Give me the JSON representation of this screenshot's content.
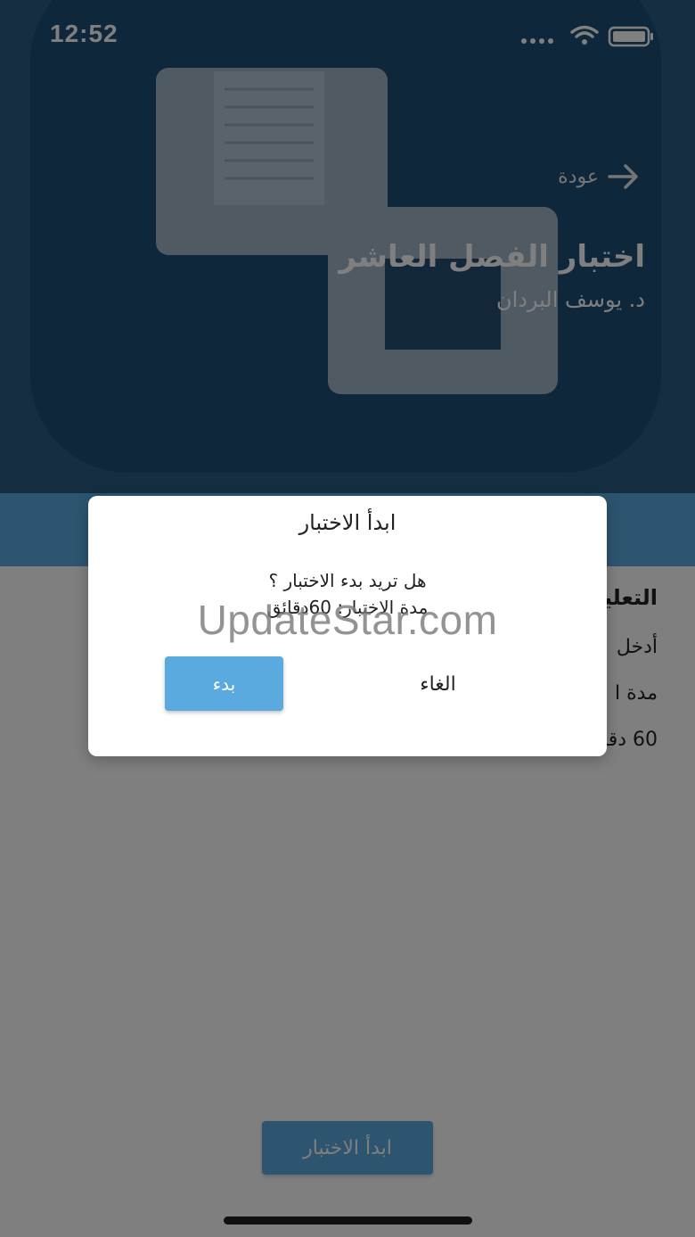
{
  "status_bar": {
    "time": "12:52"
  },
  "header": {
    "back_label": "عودة",
    "title": "اختبار الفصل العاشر",
    "subtitle": "د. يوسف البردان"
  },
  "info": {
    "heading": "التعليمات",
    "line1": "أدخل",
    "line2": "مدة ا",
    "line3": "60 دقائق"
  },
  "start_button_label": "ابدأ الاختبار",
  "dialog": {
    "title": "ابدأ الاختبار",
    "message_line1": "هل تريد بدء الاختبار ؟",
    "message_line2": "مدة الاختبار: 60دقائق",
    "confirm_label": "بدء",
    "cancel_label": "الغاء"
  },
  "watermark": "UpdateStar.com",
  "colors": {
    "primary": "#5aaae0",
    "hero": "#2b5d84"
  }
}
